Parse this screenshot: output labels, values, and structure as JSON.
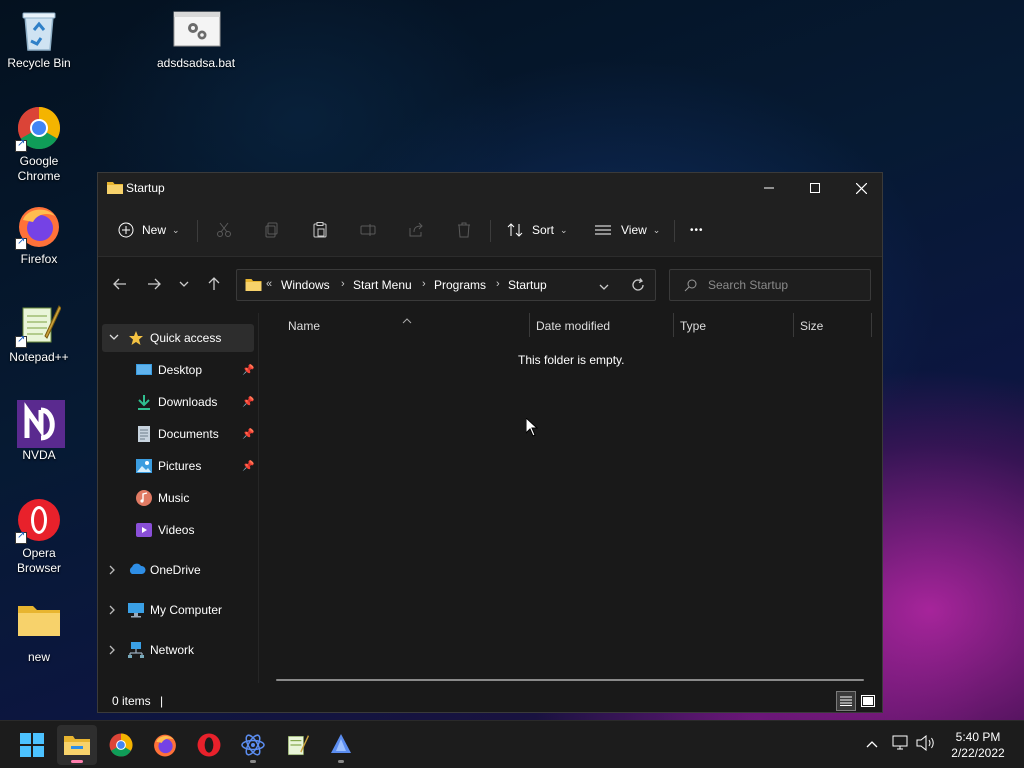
{
  "desktop": {
    "icons": [
      {
        "label": "Recycle Bin"
      },
      {
        "label": "adsdsadsa.bat"
      },
      {
        "label": "Google Chrome"
      },
      {
        "label": "Firefox"
      },
      {
        "label": "Notepad++"
      },
      {
        "label": "NVDA"
      },
      {
        "label": "Opera Browser"
      },
      {
        "label": "new"
      }
    ]
  },
  "window": {
    "title": "Startup",
    "commands": {
      "new_label": "New",
      "sort_label": "Sort",
      "view_label": "View",
      "more_label": "•••"
    },
    "address": {
      "overflow": "«",
      "crumbs": [
        "Windows",
        "Start Menu",
        "Programs",
        "Startup"
      ],
      "separator": "›"
    },
    "search": {
      "placeholder": "Search Startup"
    },
    "nav_pane": {
      "quick_access": "Quick access",
      "pinned": [
        {
          "label": "Desktop",
          "pinned": true
        },
        {
          "label": "Downloads",
          "pinned": true
        },
        {
          "label": "Documents",
          "pinned": true
        },
        {
          "label": "Pictures",
          "pinned": true
        },
        {
          "label": "Music",
          "pinned": false
        },
        {
          "label": "Videos",
          "pinned": false
        }
      ],
      "roots": [
        {
          "label": "OneDrive"
        },
        {
          "label": "My Computer"
        },
        {
          "label": "Network"
        }
      ]
    },
    "columns": [
      "Name",
      "Date modified",
      "Type",
      "Size"
    ],
    "empty_message": "This folder is empty.",
    "status": {
      "items_text": "0 items",
      "separator": "|"
    }
  },
  "taskbar": {
    "apps": [
      "start",
      "file-explorer",
      "chrome",
      "firefox",
      "opera",
      "electron-app",
      "notepad-plus-plus",
      "nvda"
    ],
    "active_app": "file-explorer",
    "clock": {
      "time": "5:40 PM",
      "date": "2/22/2022"
    }
  },
  "colors": {
    "window_bg": "#191919",
    "titlebar_bg": "#202020",
    "accent_folder": "#f7c948",
    "active_indicator": "#ff7fae"
  }
}
